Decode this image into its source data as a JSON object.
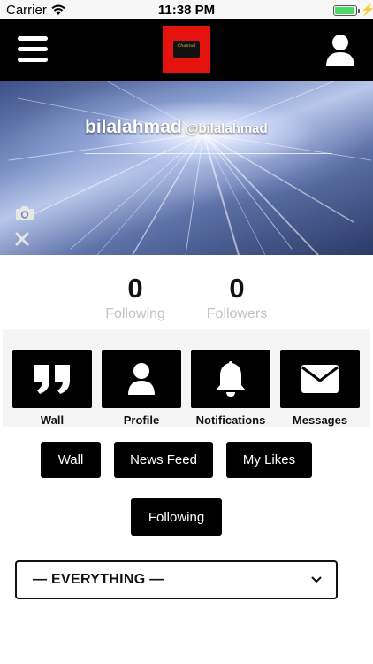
{
  "status_bar": {
    "carrier": "Carrier",
    "time": "11:38 PM",
    "battery_level": 0.9
  },
  "nav": {
    "logo_text": "Channel",
    "menu_icon": "hamburger-menu-icon",
    "account_icon": "user-icon"
  },
  "profile": {
    "display_name": "bilalahmad",
    "handle": "@bilalahmad"
  },
  "stats": {
    "following_count": "0",
    "following_label": "Following",
    "followers_count": "0",
    "followers_label": "Followers"
  },
  "tiles": [
    {
      "label": "Wall",
      "icon": "quote-icon"
    },
    {
      "label": "Profile",
      "icon": "user-icon"
    },
    {
      "label": "Notifications",
      "icon": "bell-icon"
    },
    {
      "label": "Messages",
      "icon": "envelope-icon"
    }
  ],
  "filter_buttons": {
    "wall": "Wall",
    "news_feed": "News Feed",
    "my_likes": "My Likes",
    "following": "Following"
  },
  "feed_filter": {
    "selected": "— EVERYTHING —"
  },
  "colors": {
    "bar_background": "#000000",
    "logo_red": "#e4130f",
    "battery_green": "#4cd964",
    "muted_label": "#c2c2c2"
  }
}
